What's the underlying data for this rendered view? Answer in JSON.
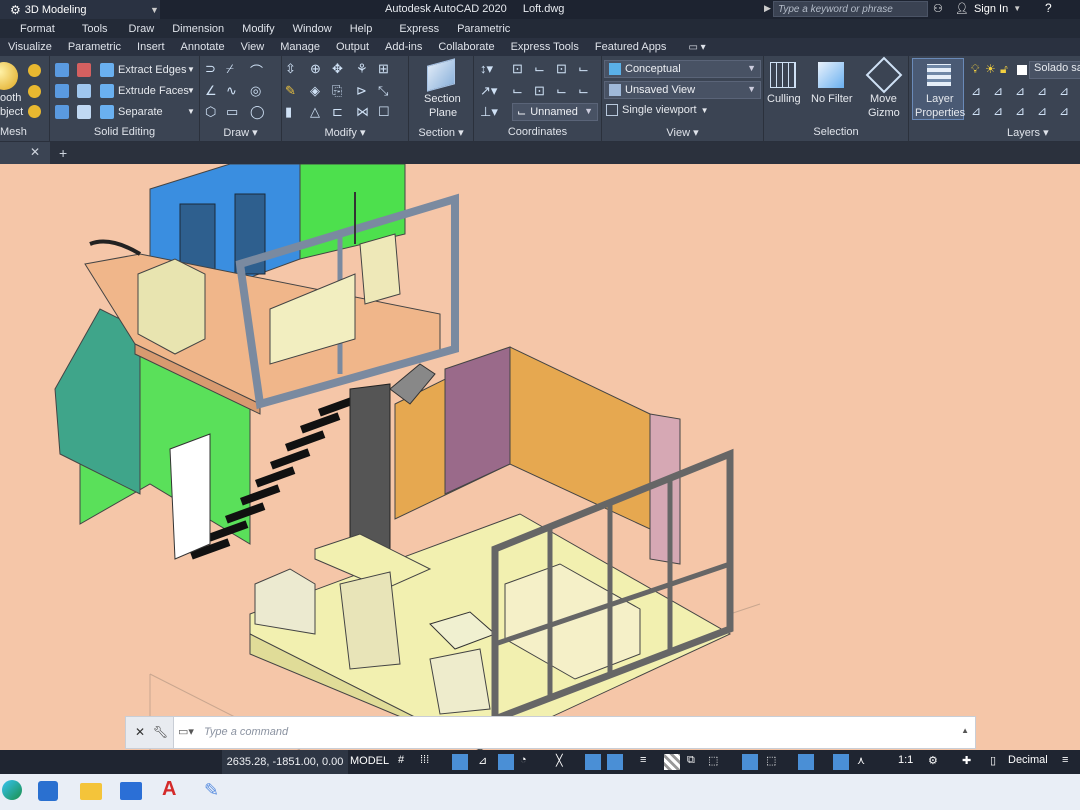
{
  "titlebar": {
    "workspace": "3D Modeling",
    "app_title": "Autodesk AutoCAD 2020",
    "file_name": "Loft.dwg",
    "search_placeholder": "Type a keyword or phrase",
    "sign_in": "Sign In"
  },
  "menubar": [
    "Format",
    "Tools",
    "Draw",
    "Dimension",
    "Modify",
    "Window",
    "Help",
    "Express",
    "Parametric"
  ],
  "ribbon_tabs": [
    "Visualize",
    "Parametric",
    "Insert",
    "Annotate",
    "View",
    "Manage",
    "Output",
    "Add-ins",
    "Collaborate",
    "Express Tools",
    "Featured Apps"
  ],
  "ribbon": {
    "mesh": {
      "smooth_label_1": "ooth",
      "smooth_label_2": "bject",
      "title": "Mesh"
    },
    "solid_editing": {
      "extract_edges": "Extract Edges",
      "extrude_faces": "Extrude Faces",
      "separate": "Separate",
      "title": "Solid Editing"
    },
    "draw": {
      "title": "Draw"
    },
    "modify": {
      "title": "Modify"
    },
    "section": {
      "label_1": "Section",
      "label_2": "Plane",
      "title": "Section"
    },
    "coordinates": {
      "ucs_name": "Unnamed",
      "title": "Coordinates"
    },
    "view": {
      "visual_style": "Conceptual",
      "named_view": "Unsaved View",
      "viewport": "Single viewport",
      "title": "View"
    },
    "selection": {
      "culling": "Culling",
      "no_filter": "No Filter",
      "move_gizmo_1": "Move",
      "move_gizmo_2": "Gizmo",
      "title": "Selection"
    },
    "layers": {
      "layer_props_1": "Layer",
      "layer_props_2": "Properties",
      "current_layer": "Solado sal",
      "title": "Layers"
    }
  },
  "command_line": {
    "placeholder": "Type a command"
  },
  "statusbar": {
    "coords": "2635.28, -1851.00, 0.00",
    "model": "MODEL",
    "scale": "1:1",
    "units": "Decimal"
  },
  "colors": {
    "viewport_bg": "#f5c6a8",
    "ribbon_bg": "#3b4453",
    "titlebar_bg": "#1d2330",
    "accent": "#4a8fd6"
  }
}
